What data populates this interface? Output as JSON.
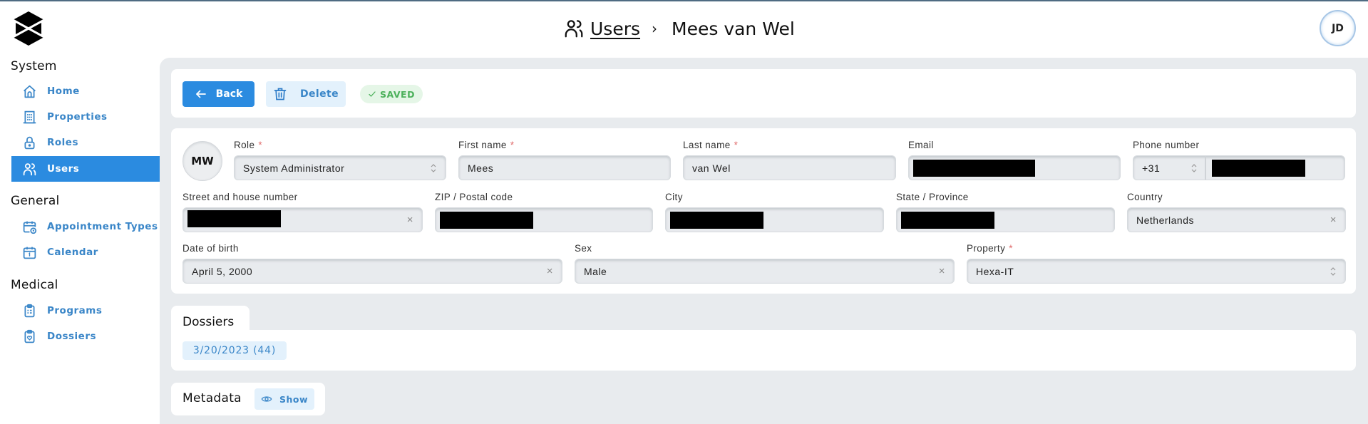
{
  "header": {
    "breadcrumb_icon": "users-icon",
    "breadcrumb_parent": "Users",
    "breadcrumb_separator": "›",
    "breadcrumb_current": "Mees van Wel",
    "user_avatar_initials": "JD"
  },
  "sidebar": {
    "logo": "hexagon-x-logo",
    "sections": [
      {
        "title": "System",
        "items": [
          {
            "label": "Home",
            "icon": "home-icon",
            "active": false
          },
          {
            "label": "Properties",
            "icon": "building-icon",
            "active": false
          },
          {
            "label": "Roles",
            "icon": "lock-icon",
            "active": false
          },
          {
            "label": "Users",
            "icon": "users-icon",
            "active": true
          }
        ]
      },
      {
        "title": "General",
        "items": [
          {
            "label": "Appointment Types",
            "icon": "calendar-clock-icon",
            "active": false
          },
          {
            "label": "Calendar",
            "icon": "calendar-icon",
            "active": false
          }
        ]
      },
      {
        "title": "Medical",
        "items": [
          {
            "label": "Programs",
            "icon": "clipboard-list-icon",
            "active": false
          },
          {
            "label": "Dossiers",
            "icon": "clipboard-heart-icon",
            "active": false
          }
        ]
      }
    ]
  },
  "toolbar": {
    "back_label": "Back",
    "delete_label": "Delete",
    "status_label": "SAVED"
  },
  "form": {
    "avatar_initials": "MW",
    "role": {
      "label": "Role",
      "required": true,
      "value": "System Administrator"
    },
    "first_name": {
      "label": "First name",
      "required": true,
      "value": "Mees"
    },
    "last_name": {
      "label": "Last name",
      "required": true,
      "value": "van Wel"
    },
    "email": {
      "label": "Email",
      "required": false,
      "value": "[redacted]"
    },
    "phone": {
      "label": "Phone number",
      "required": false,
      "prefix": "+31",
      "value": "[redacted]"
    },
    "street": {
      "label": "Street and house number",
      "required": false,
      "value": "[redacted]"
    },
    "zip": {
      "label": "ZIP / Postal code",
      "required": false,
      "value": "[redacted]"
    },
    "city": {
      "label": "City",
      "required": false,
      "value": "[redacted]"
    },
    "state": {
      "label": "State / Province",
      "required": false,
      "value": "[redacted]"
    },
    "country": {
      "label": "Country",
      "required": false,
      "value": "Netherlands"
    },
    "dob": {
      "label": "Date of birth",
      "required": false,
      "value": "April 5, 2000"
    },
    "sex": {
      "label": "Sex",
      "required": false,
      "value": "Male"
    },
    "property": {
      "label": "Property",
      "required": true,
      "value": "Hexa-IT"
    }
  },
  "dossiers": {
    "title": "Dossiers",
    "items": [
      {
        "label": "3/20/2023 (44)"
      }
    ]
  },
  "metadata": {
    "title": "Metadata",
    "show_label": "Show"
  },
  "colors": {
    "accent": "#2b8be0",
    "accent_light": "#e3f1fc",
    "link_text": "#3a86c8",
    "saved_green": "#4bb05a",
    "required_red": "#e06c6c",
    "main_bg": "#e8ebee"
  }
}
